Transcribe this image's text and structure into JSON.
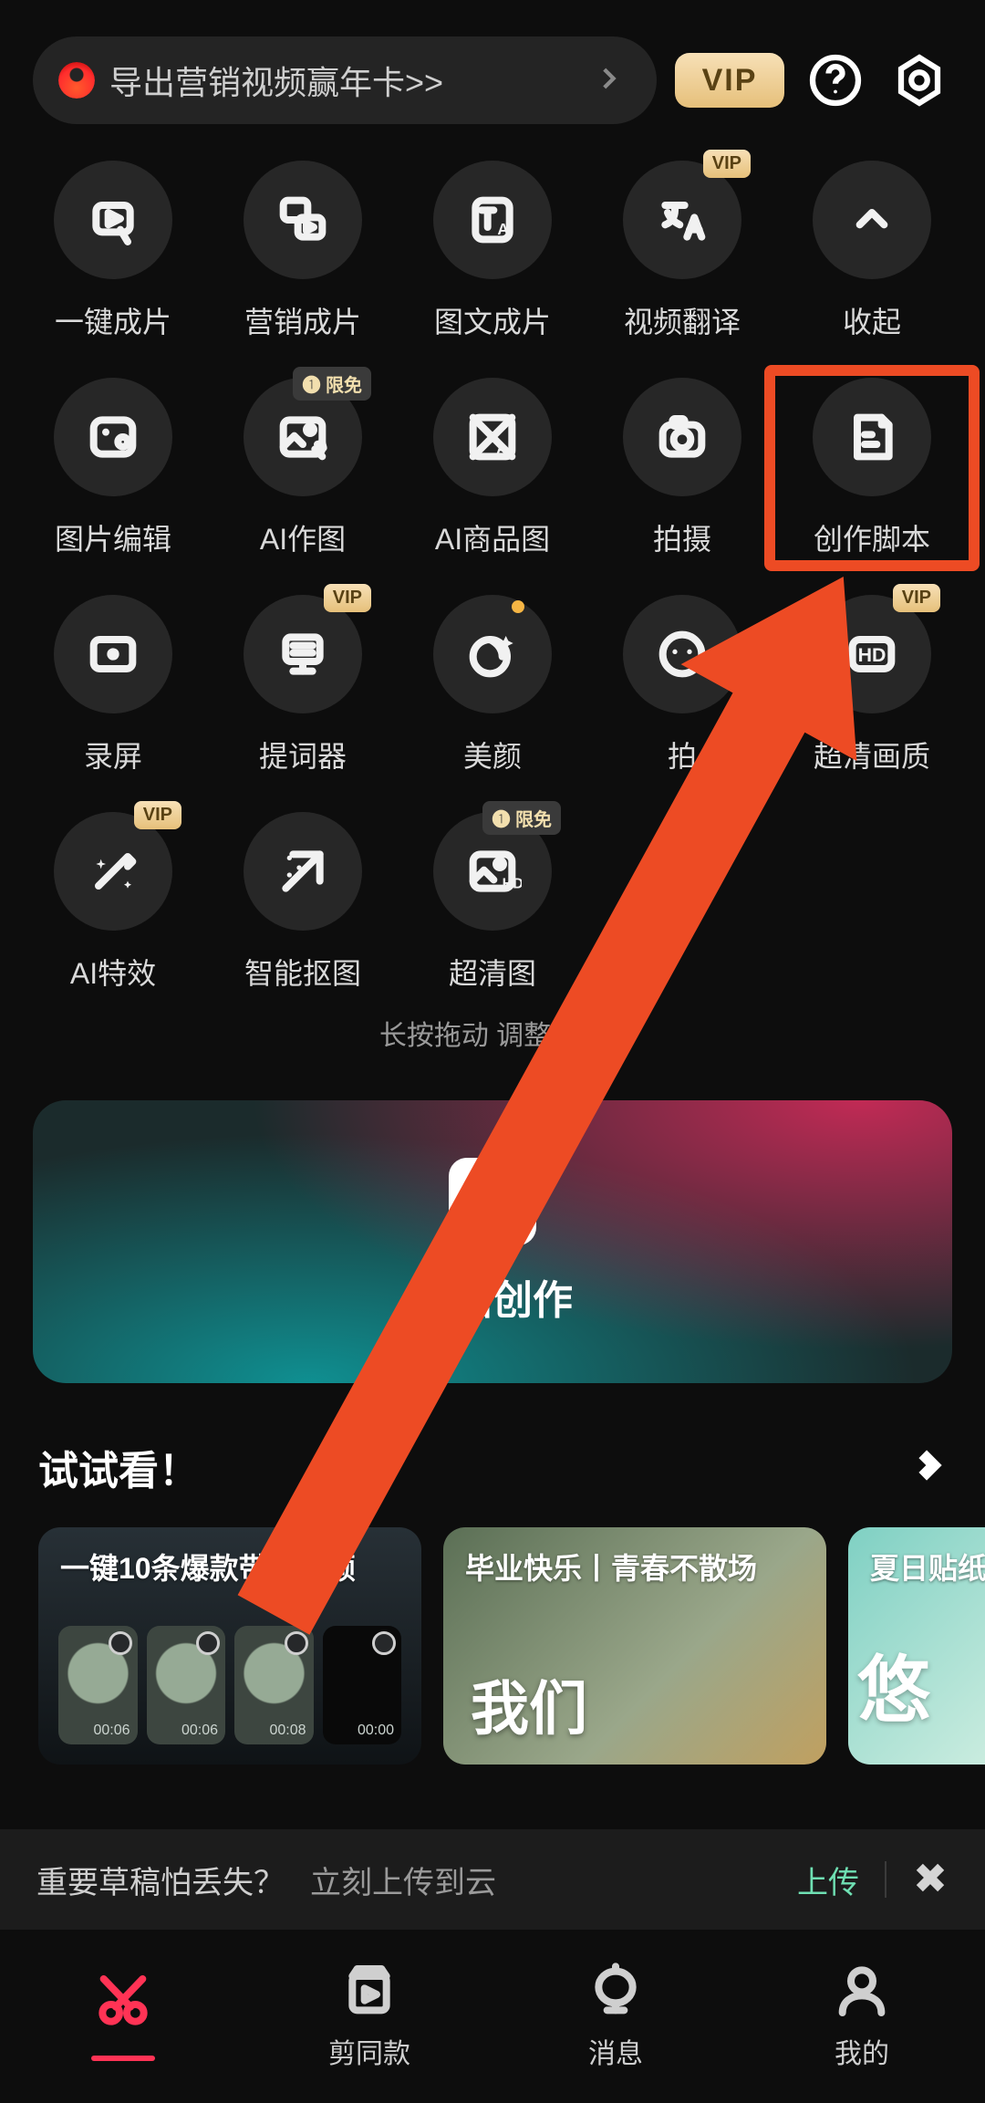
{
  "header": {
    "banner_text": "导出营销视频赢年卡>>",
    "vip_label": "VIP"
  },
  "tools": [
    {
      "key": "one_click",
      "label": "一键成片",
      "badge": null
    },
    {
      "key": "marketing",
      "label": "营销成片",
      "badge": null
    },
    {
      "key": "text_img",
      "label": "图文成片",
      "badge": null
    },
    {
      "key": "translate",
      "label": "视频翻译",
      "badge": "VIP"
    },
    {
      "key": "collapse",
      "label": "收起",
      "badge": null
    },
    {
      "key": "photo_edit",
      "label": "图片编辑",
      "badge": null
    },
    {
      "key": "ai_draw",
      "label": "AI作图",
      "badge": "限免"
    },
    {
      "key": "ai_product",
      "label": "AI商品图",
      "badge": null
    },
    {
      "key": "shoot",
      "label": "拍摄",
      "badge": null
    },
    {
      "key": "script",
      "label": "创作脚本",
      "badge": null
    },
    {
      "key": "screen_rec",
      "label": "录屏",
      "badge": null
    },
    {
      "key": "teleprompt",
      "label": "提词器",
      "badge": "VIP"
    },
    {
      "key": "beauty",
      "label": "美颜",
      "badge": null,
      "dot": true
    },
    {
      "key": "snap",
      "label": "拍",
      "badge": null
    },
    {
      "key": "hd",
      "label": "超清画质",
      "badge": "VIP"
    },
    {
      "key": "ai_fx",
      "label": "AI特效",
      "badge": "VIP"
    },
    {
      "key": "matting",
      "label": "智能抠图",
      "badge": null
    },
    {
      "key": "hd_img",
      "label": "超清图",
      "badge": "限免"
    }
  ],
  "hint_text": "长按拖动  调整顺序",
  "start_label": "开始创作",
  "try_section": {
    "title": "试试看！",
    "cards": [
      {
        "title": "一键10条爆款带货视频",
        "thumbs": [
          "00:06",
          "00:06",
          "00:08",
          "00:00"
        ]
      },
      {
        "title": "毕业快乐丨青春不散场",
        "art": "我们"
      },
      {
        "title": "夏日贴纸",
        "art": "悠"
      }
    ]
  },
  "draft_bar": {
    "question": "重要草稿怕丢失？",
    "action": "立刻上传到云",
    "upload_label": "上传"
  },
  "nav": [
    {
      "key": "cut",
      "label": ""
    },
    {
      "key": "template",
      "label": "剪同款"
    },
    {
      "key": "msg",
      "label": "消息"
    },
    {
      "key": "me",
      "label": "我的"
    }
  ],
  "annotation": {
    "highlight_tool_index": 9
  }
}
